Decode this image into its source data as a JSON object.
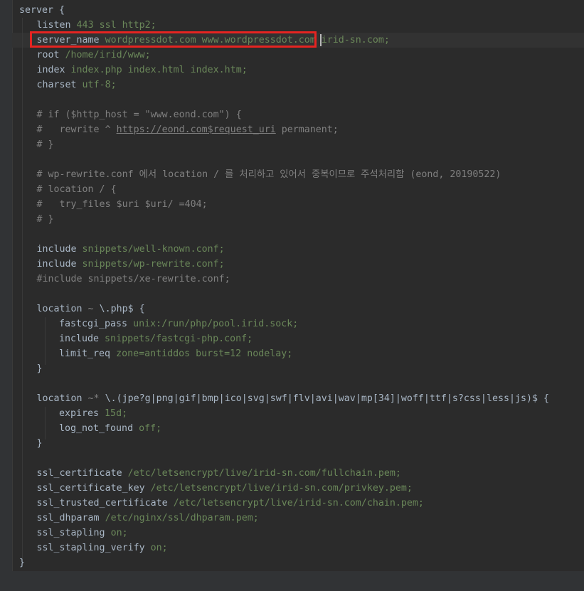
{
  "code_lines": [
    {
      "parts": [
        [
          "server",
          "kw"
        ],
        [
          " {",
          "brace"
        ]
      ]
    },
    {
      "parts": [
        [
          "listen",
          "dir"
        ],
        [
          " 443 ssl http2;",
          "val"
        ]
      ]
    },
    {
      "parts": [
        [
          "server_name",
          "dir"
        ],
        [
          " wordpressdot.com www.wordpressdot.com irid-sn.com;",
          "val"
        ]
      ]
    },
    {
      "parts": [
        [
          "root",
          "dir"
        ],
        [
          " /home/irid/www;",
          "val"
        ]
      ]
    },
    {
      "parts": [
        [
          "index",
          "dir"
        ],
        [
          " index.php index.html index.htm;",
          "val"
        ]
      ]
    },
    {
      "parts": [
        [
          "charset",
          "dir"
        ],
        [
          " utf-8;",
          "val"
        ]
      ]
    },
    {
      "parts": []
    },
    {
      "parts": [
        [
          "# if ($http_host = \"www.eond.com\") {",
          "cmt"
        ]
      ]
    },
    {
      "parts": [
        [
          "#   rewrite ^ ",
          "cmt"
        ],
        [
          "https://eond.com$request_uri",
          "url"
        ],
        [
          " permanent;",
          "cmt"
        ]
      ]
    },
    {
      "parts": [
        [
          "# }",
          "cmt"
        ]
      ]
    },
    {
      "parts": []
    },
    {
      "parts": [
        [
          "# wp-rewrite.conf 에서 location / 를 처리하고 있어서 중복이므로 주석처리함 (eond, 20190522)",
          "cmt"
        ]
      ]
    },
    {
      "parts": [
        [
          "# location / {",
          "cmt"
        ]
      ]
    },
    {
      "parts": [
        [
          "#   try_files $uri $uri/ =404;",
          "cmt"
        ]
      ]
    },
    {
      "parts": [
        [
          "# }",
          "cmt"
        ]
      ]
    },
    {
      "parts": []
    },
    {
      "parts": [
        [
          "include",
          "dir"
        ],
        [
          " snippets/well-known.conf;",
          "val"
        ]
      ]
    },
    {
      "parts": [
        [
          "include",
          "dir"
        ],
        [
          " snippets/wp-rewrite.conf;",
          "val"
        ]
      ]
    },
    {
      "parts": [
        [
          "#include snippets/xe-rewrite.conf;",
          "cmt"
        ]
      ]
    },
    {
      "parts": []
    },
    {
      "parts": [
        [
          "location",
          "dir"
        ],
        [
          " ~ ",
          "op"
        ],
        [
          "\\.php$ {",
          "brace"
        ]
      ]
    },
    {
      "parts": [
        [
          "fastcgi_pass",
          "dir"
        ],
        [
          " unix:/run/php/pool.irid.sock;",
          "val"
        ]
      ],
      "indent": 2
    },
    {
      "parts": [
        [
          "include",
          "dir"
        ],
        [
          " snippets/fastcgi-php.conf;",
          "val"
        ]
      ],
      "indent": 2
    },
    {
      "parts": [
        [
          "limit_req",
          "dir"
        ],
        [
          " zone=antiddos burst=12 nodelay;",
          "val"
        ]
      ],
      "indent": 2
    },
    {
      "parts": [
        [
          "}",
          "brace"
        ]
      ]
    },
    {
      "parts": []
    },
    {
      "parts": [
        [
          "location",
          "dir"
        ],
        [
          " ~* ",
          "op"
        ],
        [
          "\\.(jpe?g|png|gif|bmp|ico|svg|swf|flv|avi|wav|mp[34]|woff|ttf|s?css|less|js)$ {",
          "brace"
        ]
      ]
    },
    {
      "parts": [
        [
          "expires",
          "dir"
        ],
        [
          " 15d;",
          "val"
        ]
      ],
      "indent": 2
    },
    {
      "parts": [
        [
          "log_not_found",
          "dir"
        ],
        [
          " off;",
          "val"
        ]
      ],
      "indent": 2
    },
    {
      "parts": [
        [
          "}",
          "brace"
        ]
      ]
    },
    {
      "parts": []
    },
    {
      "parts": [
        [
          "ssl_certificate",
          "dir"
        ],
        [
          " /etc/letsencrypt/live/irid-sn.com/fullchain.pem;",
          "val"
        ]
      ]
    },
    {
      "parts": [
        [
          "ssl_certificate_key",
          "dir"
        ],
        [
          " /etc/letsencrypt/live/irid-sn.com/privkey.pem;",
          "val"
        ]
      ]
    },
    {
      "parts": [
        [
          "ssl_trusted_certificate",
          "dir"
        ],
        [
          " /etc/letsencrypt/live/irid-sn.com/chain.pem;",
          "val"
        ]
      ]
    },
    {
      "parts": [
        [
          "ssl_dhparam",
          "dir"
        ],
        [
          " /etc/nginx/ssl/dhparam.pem;",
          "val"
        ]
      ]
    },
    {
      "parts": [
        [
          "ssl_stapling",
          "dir"
        ],
        [
          " on;",
          "val"
        ]
      ]
    },
    {
      "parts": [
        [
          "ssl_stapling_verify",
          "dir"
        ],
        [
          " on;",
          "val"
        ]
      ]
    },
    {
      "parts": [
        [
          "}",
          "brace"
        ]
      ],
      "indent": 0
    }
  ],
  "colors": {
    "background": "#2b2b2b",
    "highlight_box": "#e52421",
    "string_value": "#6a8759",
    "comment": "#808080",
    "keyword": "#a9b7c6"
  }
}
